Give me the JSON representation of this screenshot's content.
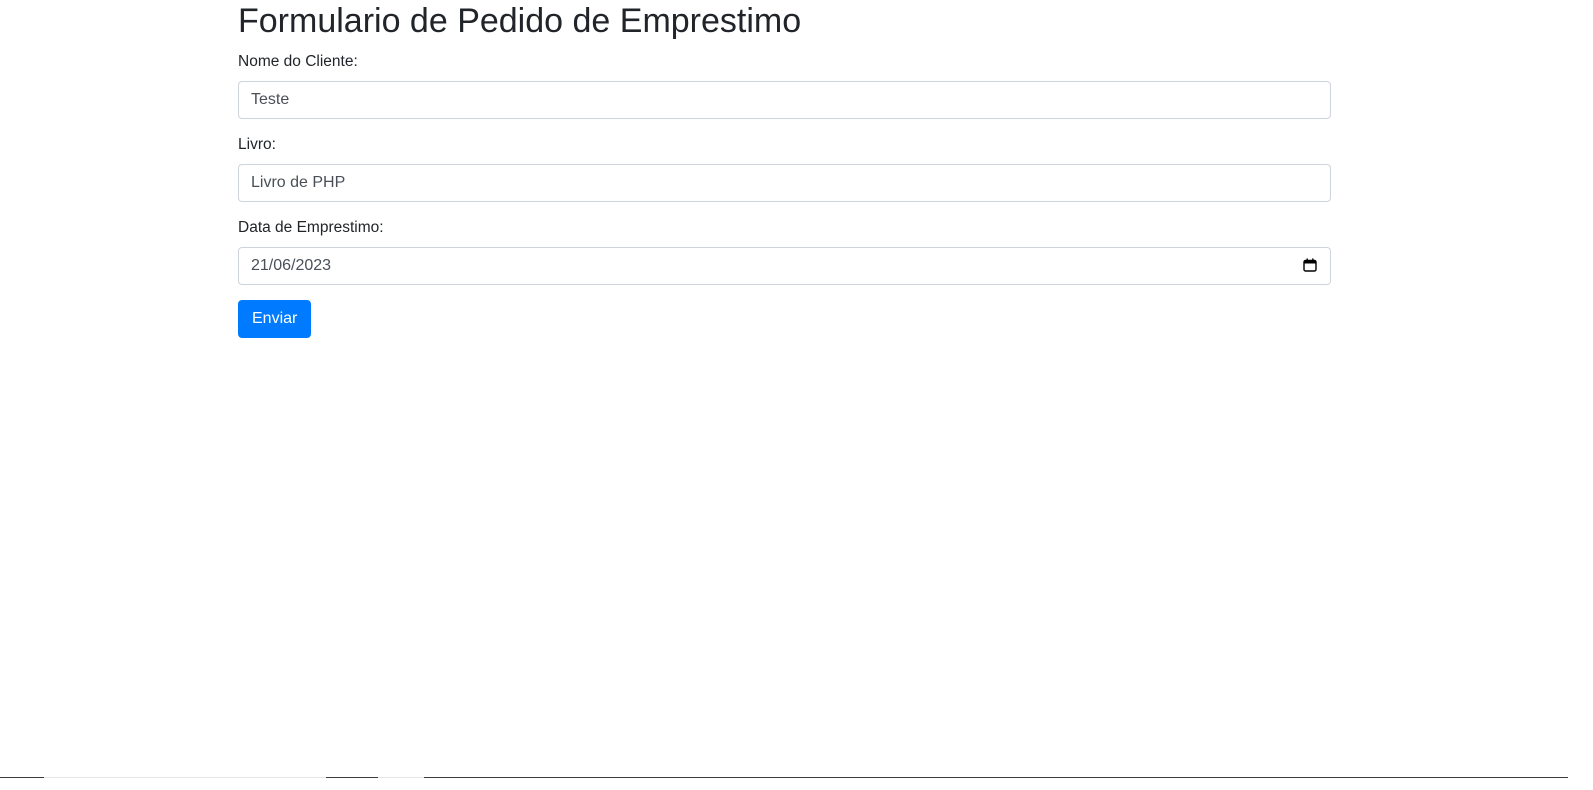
{
  "form": {
    "title": "Formulario de Pedido de Emprestimo",
    "fields": [
      {
        "label": "Nome do Cliente:",
        "value": "Teste",
        "type": "text"
      },
      {
        "label": "Livro:",
        "value": "Livro de PHP",
        "type": "text"
      },
      {
        "label": "Data de Emprestimo:",
        "value": "21/06/2023",
        "type": "date"
      }
    ],
    "submit_label": "Enviar"
  },
  "colors": {
    "primary_button": "#007bff",
    "text": "#212529",
    "input_border": "#ced4da"
  },
  "icons": {
    "date_picker": "calendar-icon"
  }
}
